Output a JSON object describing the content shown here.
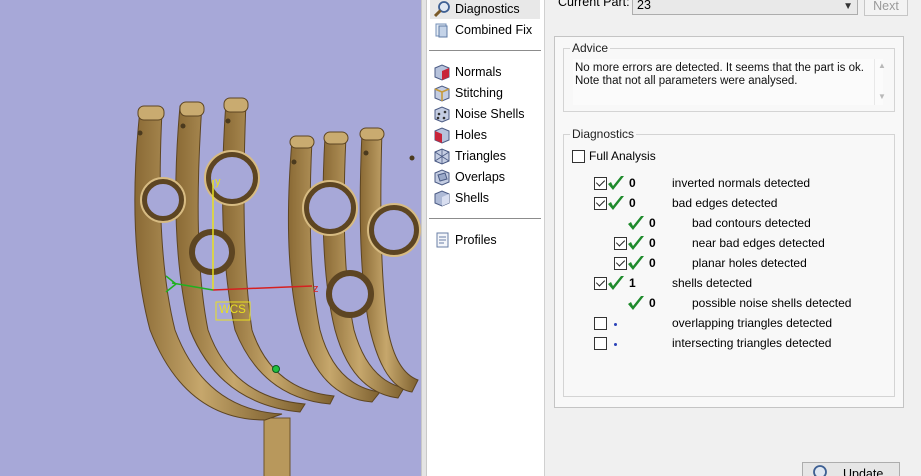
{
  "nav": {
    "items": [
      {
        "label": "Diagnostics",
        "icon": "magnifier-icon",
        "selected": true
      },
      {
        "label": "Combined Fix",
        "icon": "combined-fix-icon"
      },
      {
        "label": "Normals",
        "icon": "normals-cube-icon"
      },
      {
        "label": "Stitching",
        "icon": "stitching-cube-icon"
      },
      {
        "label": "Noise Shells",
        "icon": "noise-shells-cube-icon"
      },
      {
        "label": "Holes",
        "icon": "holes-cube-icon"
      },
      {
        "label": "Triangles",
        "icon": "triangles-cube-icon"
      },
      {
        "label": "Overlaps",
        "icon": "overlaps-cube-icon"
      },
      {
        "label": "Shells",
        "icon": "shells-cube-icon"
      },
      {
        "label": "Profiles",
        "icon": "profiles-page-icon"
      }
    ]
  },
  "header": {
    "current_part_label": "Current Part:",
    "current_part_value": "23",
    "next_label": "Next"
  },
  "advice": {
    "title": "Advice",
    "line1": "No more errors are detected. It seems that the part is ok.",
    "line2": "Note that not all parameters were analysed."
  },
  "diagnostics": {
    "title": "Diagnostics",
    "full_analysis_label": "Full Analysis",
    "full_analysis_checked": false,
    "rows": [
      {
        "checkbox": true,
        "checked": true,
        "status": "ok",
        "count": "0",
        "label": "inverted normals detected",
        "indent": 0
      },
      {
        "checkbox": true,
        "checked": true,
        "status": "ok",
        "count": "0",
        "label": "bad edges detected",
        "indent": 0
      },
      {
        "checkbox": false,
        "checked": false,
        "status": "ok",
        "count": "0",
        "label": "bad contours detected",
        "indent": 1
      },
      {
        "checkbox": true,
        "checked": true,
        "status": "ok",
        "count": "0",
        "label": "near bad edges detected",
        "indent": 1
      },
      {
        "checkbox": true,
        "checked": true,
        "status": "ok",
        "count": "0",
        "label": "planar holes detected",
        "indent": 1
      },
      {
        "checkbox": true,
        "checked": true,
        "status": "ok",
        "count": "1",
        "label": "shells detected",
        "indent": 0
      },
      {
        "checkbox": false,
        "checked": false,
        "status": "ok",
        "count": "0",
        "label": "possible noise shells detected",
        "indent": 1
      },
      {
        "checkbox": true,
        "checked": false,
        "status": "pending",
        "count": "",
        "label": "overlapping triangles detected",
        "indent": 0
      },
      {
        "checkbox": true,
        "checked": false,
        "status": "pending",
        "count": "",
        "label": "intersecting triangles detected",
        "indent": 0
      }
    ],
    "update_label": "Update"
  },
  "viewport": {
    "wcs_label": "WCS",
    "axis_y": "y",
    "axis_z": "z",
    "background_color": "#a7a8d8",
    "model_color": "#b3935a"
  }
}
